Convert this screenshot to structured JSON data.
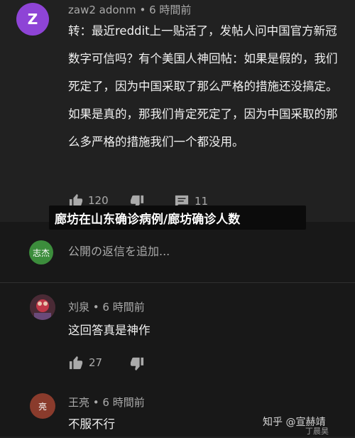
{
  "colors": {
    "background_top": "#212121",
    "background_bottom": "#181818",
    "text_primary": "#f1f1f1",
    "text_secondary": "#aaaaaa",
    "banner_bg": "#0b0b0b"
  },
  "first_comment": {
    "avatar_letter": "Z",
    "avatar_color": "#8e44d6",
    "author": "zaw2 adonm",
    "time": "6 時間前",
    "text": "转：最近reddit上一贴活了，发帖人问中国官方新冠数字可信吗？有个美国人神回帖：如果是假的，我们死定了，因为中国采取了那么严格的措施还没搞定。如果是真的，那我们肯定死定了，因为中国采取的那么多严格的措施我们一个都没用。",
    "like_count": "120",
    "reply_count": "11",
    "icons": [
      "thumb-up-icon",
      "thumb-down-icon",
      "comment-icon"
    ]
  },
  "article_title": "廊坊在山东确诊病例/廊坊确诊人数",
  "reply_box": {
    "avatar_text": "志杰",
    "avatar_color": "#3c8d3c",
    "placeholder": "公開の返信を追加..."
  },
  "replies": [
    {
      "author": "刘泉",
      "time": "6 時間前",
      "text": "这回答真是神作",
      "like_count": "27",
      "avatar_color": "#b03040"
    },
    {
      "author": "王亮",
      "time": "6 時間前",
      "text": "不服不行",
      "avatar_text": "亮",
      "avatar_color": "#8a3b2c"
    }
  ],
  "watermark": {
    "line1": "知乎 @宣赫靖",
    "line2": "丁晨昊"
  }
}
